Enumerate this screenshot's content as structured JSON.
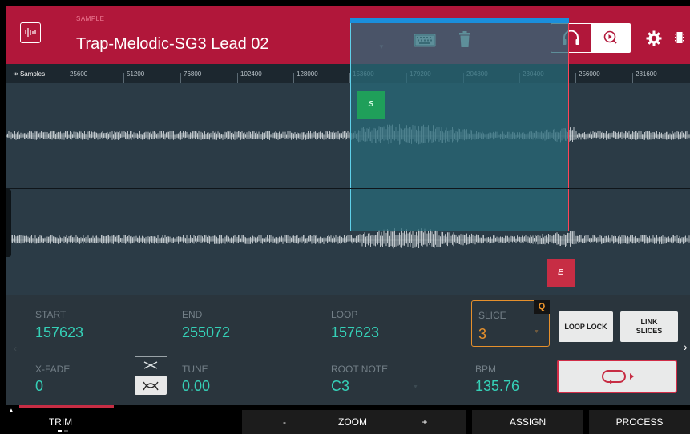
{
  "header": {
    "section_label": "SAMPLE",
    "sample_name": "Trap-Melodic-SG3 Lead 02"
  },
  "ruler": {
    "unit_label": "Samples",
    "ticks": [
      "25600",
      "51200",
      "76800",
      "102400",
      "128000",
      "153600",
      "179200",
      "204800",
      "230400",
      "256000",
      "281600"
    ]
  },
  "markers": {
    "start": "S",
    "end": "E"
  },
  "params": {
    "start": {
      "label": "START",
      "value": "157623"
    },
    "end": {
      "label": "END",
      "value": "255072"
    },
    "loop": {
      "label": "LOOP",
      "value": "157623"
    },
    "slice": {
      "label": "SLICE",
      "value": "3",
      "q_badge": "Q"
    },
    "xfade": {
      "label": "X-FADE",
      "value": "0"
    },
    "tune": {
      "label": "TUNE",
      "value": "0.00"
    },
    "root_note": {
      "label": "ROOT NOTE",
      "value": "C3"
    },
    "bpm": {
      "label": "BPM",
      "value": "135.76"
    }
  },
  "buttons": {
    "loop_lock": "LOOP LOCK",
    "link_slices": "LINK SLICES"
  },
  "bottom_bar": {
    "trim": "TRIM",
    "zoom_minus": "-",
    "zoom": "ZOOM",
    "zoom_plus": "+",
    "assign": "ASSIGN",
    "process": "PROCESS"
  },
  "colors": {
    "header": "#b1173a",
    "value_teal": "#35d0b7",
    "slice_orange": "#e6902c",
    "start_green": "#1f9f5a",
    "end_red": "#c72d44",
    "selection_blue": "#1a8fdc"
  }
}
